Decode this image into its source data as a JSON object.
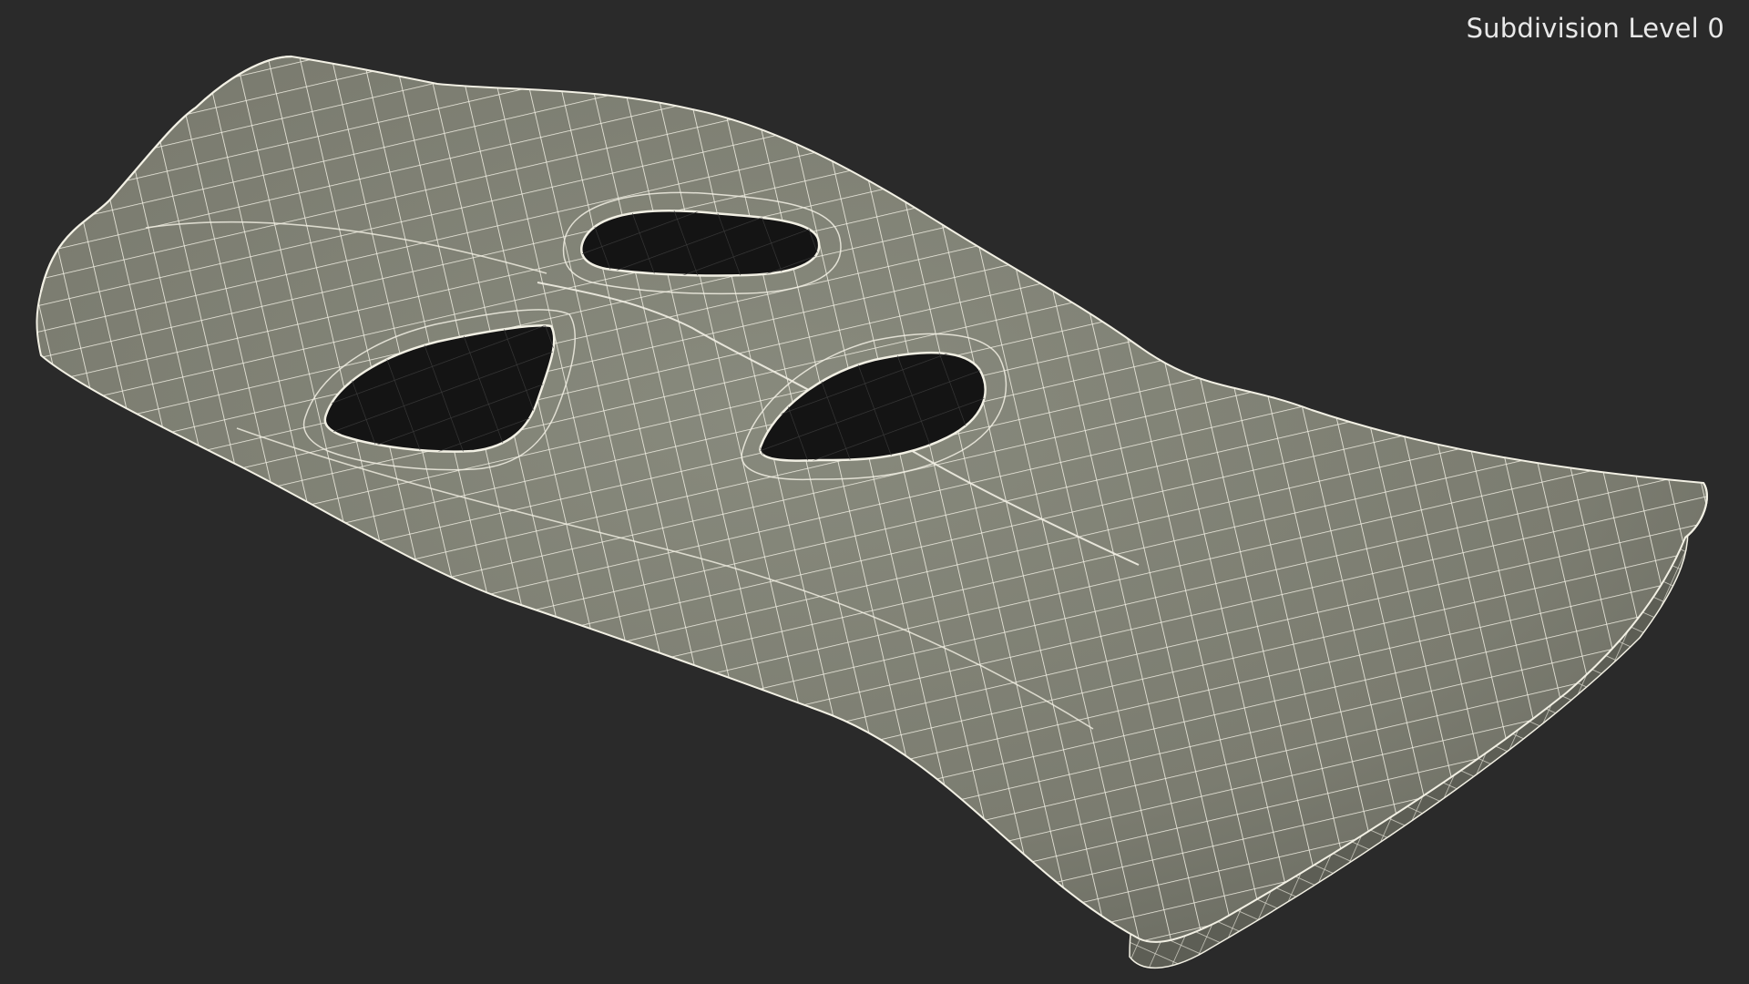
{
  "viewport": {
    "label": "Subdivision Level 0",
    "background_color": "#2a2a2a",
    "mesh_fill_color": "#7d7e72",
    "mesh_shadow_color": "#5d5e55",
    "wire_color": "#f2f0e4",
    "hole_color": "#141414",
    "hole_grid_color": "#3c3c3c"
  }
}
